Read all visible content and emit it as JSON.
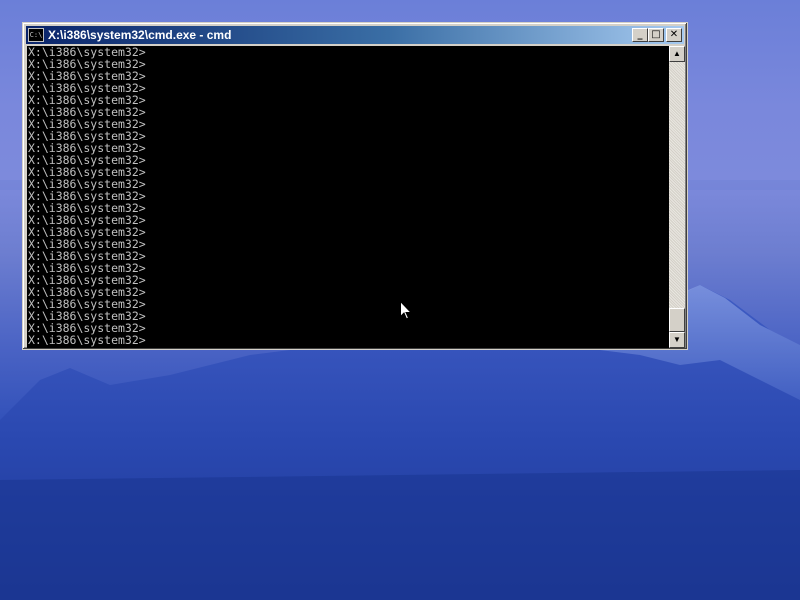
{
  "window": {
    "title": "X:\\i386\\system32\\cmd.exe - cmd",
    "icon_text": "C:\\",
    "minimize_glyph": "_",
    "maximize_glyph": "□",
    "close_glyph": "✕"
  },
  "console": {
    "lines": [
      "X:\\i386\\system32>",
      "X:\\i386\\system32>",
      "X:\\i386\\system32>",
      "X:\\i386\\system32>",
      "X:\\i386\\system32>",
      "X:\\i386\\system32>",
      "X:\\i386\\system32>",
      "X:\\i386\\system32>",
      "X:\\i386\\system32>",
      "X:\\i386\\system32>",
      "X:\\i386\\system32>",
      "X:\\i386\\system32>",
      "X:\\i386\\system32>",
      "X:\\i386\\system32>",
      "X:\\i386\\system32>",
      "X:\\i386\\system32>",
      "X:\\i386\\system32>",
      "X:\\i386\\system32>",
      "X:\\i386\\system32>",
      "X:\\i386\\system32>",
      "X:\\i386\\system32>",
      "X:\\i386\\system32>",
      "X:\\i386\\system32>",
      "X:\\i386\\system32>",
      "X:\\i386\\system32>"
    ]
  },
  "scrollbar": {
    "up_glyph": "▲",
    "down_glyph": "▼"
  },
  "colors": {
    "console_bg": "#000000",
    "console_text": "#c0c0c0",
    "titlebar_start": "#0a246a",
    "titlebar_end": "#a6caf0"
  }
}
